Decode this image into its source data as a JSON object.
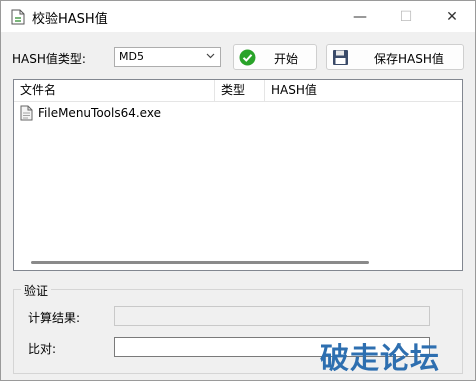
{
  "window": {
    "title": "校验HASH值",
    "min_glyph": "—",
    "max_glyph": "☐",
    "close_glyph": "✕"
  },
  "toolbar": {
    "hash_type_label": "HASH值类型:",
    "hash_type_value": "MD5",
    "start_label": "开始",
    "start_icon": "green-check-icon",
    "save_label": "保存HASH值",
    "save_icon": "floppy-disk-icon"
  },
  "file_list": {
    "columns": [
      "文件名",
      "类型",
      "HASH值"
    ],
    "rows": [
      {
        "name": "FileMenuTools64.exe",
        "type": "",
        "hash": ""
      }
    ]
  },
  "verify": {
    "group_title": "验证",
    "result_label": "计算结果:",
    "result_value": "",
    "compare_label": "比对:",
    "compare_value": ""
  },
  "watermark": "破走论坛",
  "colors": {
    "accent": "#2e6fb0",
    "check_green": "#29a329"
  }
}
